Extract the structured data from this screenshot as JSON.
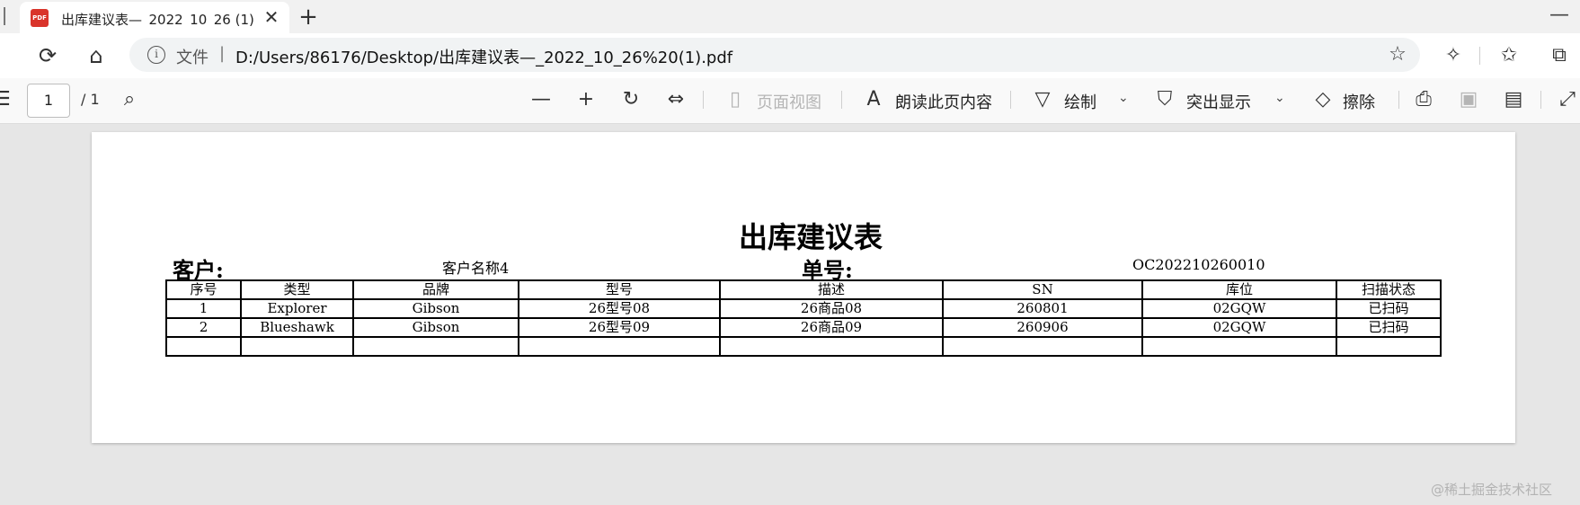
{
  "tab": {
    "icon_text": "PDF",
    "title": "出库建议表—_2022_10_26 (1).pdf",
    "close_glyph": "✕",
    "new_tab_glyph": "+"
  },
  "window": {
    "minimize_glyph": "—"
  },
  "address": {
    "label": "文件",
    "separator": "|",
    "url": "D:/Users/86176/Desktop/出库建议表—_2022_10_26%20(1).pdf"
  },
  "pdf_toolbar": {
    "page_number": "1",
    "page_total": "/ 1",
    "page_view_label": "页面视图",
    "read_aloud_label": "朗读此页内容",
    "draw_label": "绘制",
    "highlight_label": "突出显示",
    "erase_label": "擦除"
  },
  "document": {
    "title": "出库建议表",
    "customer_label": "客户:",
    "customer_value": "客户名称4",
    "order_label": "单号:",
    "order_value": "OC202210260010",
    "columns": [
      "序号",
      "类型",
      "品牌",
      "型号",
      "描述",
      "SN",
      "库位",
      "扫描状态"
    ],
    "rows": [
      [
        "1",
        "Explorer",
        "Gibson",
        "26型号08",
        "26商品08",
        "260801",
        "02GQW",
        "已扫码"
      ],
      [
        "2",
        "Blueshawk",
        "Gibson",
        "26型号09",
        "26商品09",
        "260906",
        "02GQW",
        "已扫码"
      ],
      [
        "",
        "",
        "",
        "",
        "",
        "",
        "",
        ""
      ]
    ]
  },
  "watermark": "@稀土掘金技术社区",
  "icons": {
    "refresh": "refresh-icon",
    "home": "home-icon",
    "info": "info-icon",
    "favorites-add": "add-favorite-icon",
    "extensions": "extensions-icon",
    "favorites": "favorites-icon",
    "collections": "collections-icon",
    "search": "search-icon",
    "zoom-out": "zoom-out-icon",
    "zoom-in": "zoom-in-icon",
    "rotate": "rotate-icon",
    "fit-width": "fit-width-icon",
    "print": "print-icon",
    "save": "save-icon",
    "save-as": "save-as-icon",
    "fullscreen": "fullscreen-icon"
  }
}
